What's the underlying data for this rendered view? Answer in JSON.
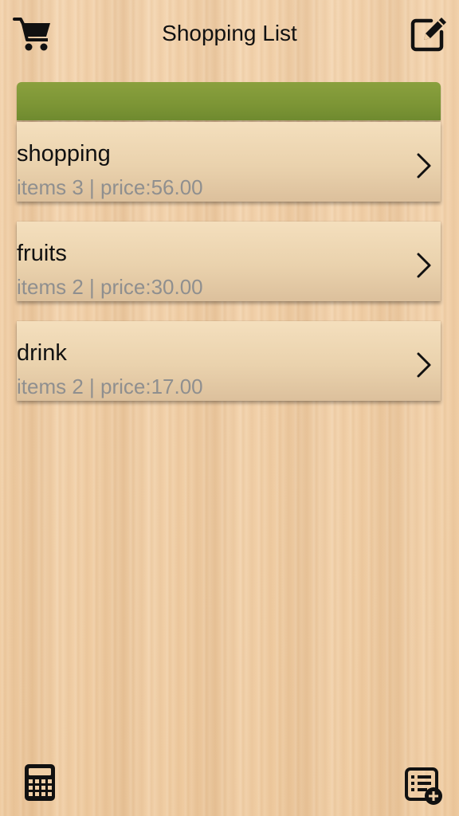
{
  "header": {
    "title": "Shopping List",
    "left_icon": "cart-icon",
    "right_icon": "edit-icon"
  },
  "theme": {
    "accent": "#7c9535",
    "card_top": "#f4dfbd",
    "card_bottom": "#dcc09c",
    "meta_text": "#8f8f8f",
    "background": "#f0cfa6"
  },
  "lists": [
    {
      "name": "shopping",
      "meta": "items 3 | price:56.00"
    },
    {
      "name": "fruits",
      "meta": "items 2 | price:30.00"
    },
    {
      "name": "drink",
      "meta": "items 2 | price:17.00"
    }
  ],
  "footer": {
    "left_icon": "calculator-icon",
    "right_icon": "add-list-icon"
  }
}
